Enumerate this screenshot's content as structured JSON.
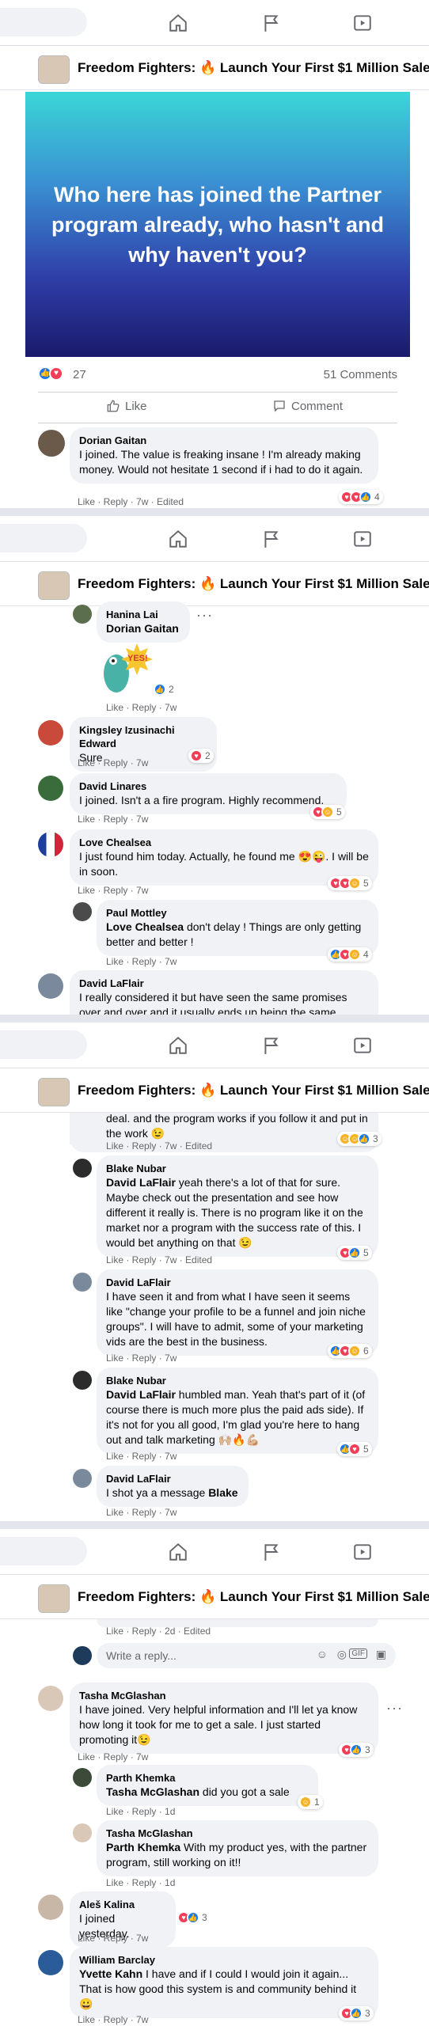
{
  "group_title": "Freedom Fighters: 🔥 Launch Your First $1 Million Sales Funnel",
  "post": {
    "banner_text": "Who here has joined the Partner program already, who hasn't and why haven't you?",
    "like_count": "27",
    "comment_count": "51 Comments",
    "like_label": "Like",
    "comment_label": "Comment"
  },
  "nav_icons": [
    "home-icon",
    "flag-icon",
    "video-icon"
  ],
  "seg1": {
    "c1": {
      "name": "Dorian Gaitan",
      "text": "I joined. The value is freaking insane ! I'm already making money. Would not hesitate 1 second if i had to do it again.",
      "meta": "Like · Reply · 7w · Edited",
      "reacts": "4"
    }
  },
  "seg2": {
    "c1": {
      "name": "Hanina Lai",
      "tag": "Dorian Gaitan",
      "sticker": "YES!",
      "reacts": "2",
      "meta": "Like · Reply · 7w"
    },
    "c2": {
      "name": "Kingsley Izusinachi Edward",
      "text": "Sure",
      "meta": "Like · Reply · 7w",
      "reacts": "2"
    },
    "c3": {
      "name": "David Linares",
      "text": "I joined. Isn't a a fire program. Highly recommend.",
      "meta": "Like · Reply · 7w",
      "reacts": "5"
    },
    "c4": {
      "name": "Love Chealsea",
      "text": "I just found him today. Actually, he found me 😍😜. I will be in soon.",
      "meta": "Like · Reply · 7w",
      "reacts": "5"
    },
    "c5": {
      "name": "Paul Mottley",
      "tag": "Love Chealsea",
      "text": " don't delay ! Things are only getting better and better !",
      "meta": "Like · Reply · 7w",
      "reacts": "4"
    },
    "c6": {
      "name": "David LaFlair",
      "text": "I really considered it but have seen the same promises over and over and it usually ends up being the same"
    }
  },
  "seg3": {
    "c0": {
      "text": "deal. and the program works if you follow it and put in the work 😉",
      "meta": "Like · Reply · 7w · Edited",
      "reacts": "3"
    },
    "c1": {
      "name": "Blake Nubar",
      "tag": "David LaFlair",
      "text": " yeah there's a lot of that for sure. Maybe check out the presentation and see how different it really is. There is no program like it on the market nor a program with the success rate of this. I would bet anything on that 😉",
      "meta": "Like · Reply · 7w · Edited",
      "reacts": "5"
    },
    "c2": {
      "name": "David LaFlair",
      "text": "I have seen it and from what I have seen it seems like \"change your profile to be a funnel and join niche groups\". I will have to admit, some of your marketing vids are the best in the business.",
      "meta": "Like · Reply · 7w",
      "reacts": "6"
    },
    "c3": {
      "name": "Blake Nubar",
      "tag": "David LaFlair",
      "text": " humbled man. Yeah that's part of it (of course there is much more plus the paid ads side). If it's not for you all good, I'm glad you're here to hang out and talk marketing 🙌🏼🔥💪🏼",
      "meta": "Like · Reply · 7w",
      "reacts": "5"
    },
    "c4": {
      "name": "David LaFlair",
      "text": "I shot ya a message ",
      "tag": "Blake",
      "meta": "Like · Reply · 7w"
    }
  },
  "seg4": {
    "c0": {
      "meta": "Like · Reply · 2d · Edited"
    },
    "reply_placeholder": "Write a reply...",
    "c1": {
      "name": "Tasha McGlashan",
      "text": "I have joined. Very helpful information and I'll let ya know how long it took for me to get a sale. I just started promoting it😉",
      "meta": "Like · Reply · 7w",
      "reacts": "3"
    },
    "c2": {
      "name": "Parth Khemka",
      "tag": "Tasha McGlashan",
      "text": " did you got a sale",
      "meta": "Like · Reply · 1d",
      "reacts": "1"
    },
    "c3": {
      "name": "Tasha McGlashan",
      "tag": "Parth Khemka",
      "text": " With my product yes, with the partner program, still working on it!!",
      "meta": "Like · Reply · 1d"
    },
    "c4": {
      "name": "Aleš Kalina",
      "text": "I joined yesterday.",
      "meta": "Like · Reply · 7w",
      "reacts": "3"
    },
    "c5": {
      "name": "William Barclay",
      "tag": "Yvette Kahn",
      "text": " I have and if I could I would join it again... That is how good this system is and community behind it 😀",
      "meta": "Like · Reply · 7w",
      "reacts": "3"
    }
  },
  "colors": {
    "accent": "#1877f2",
    "love": "#f33e58",
    "haha": "#f7b125",
    "bubble": "#f0f2f5",
    "meta": "#65676b"
  }
}
